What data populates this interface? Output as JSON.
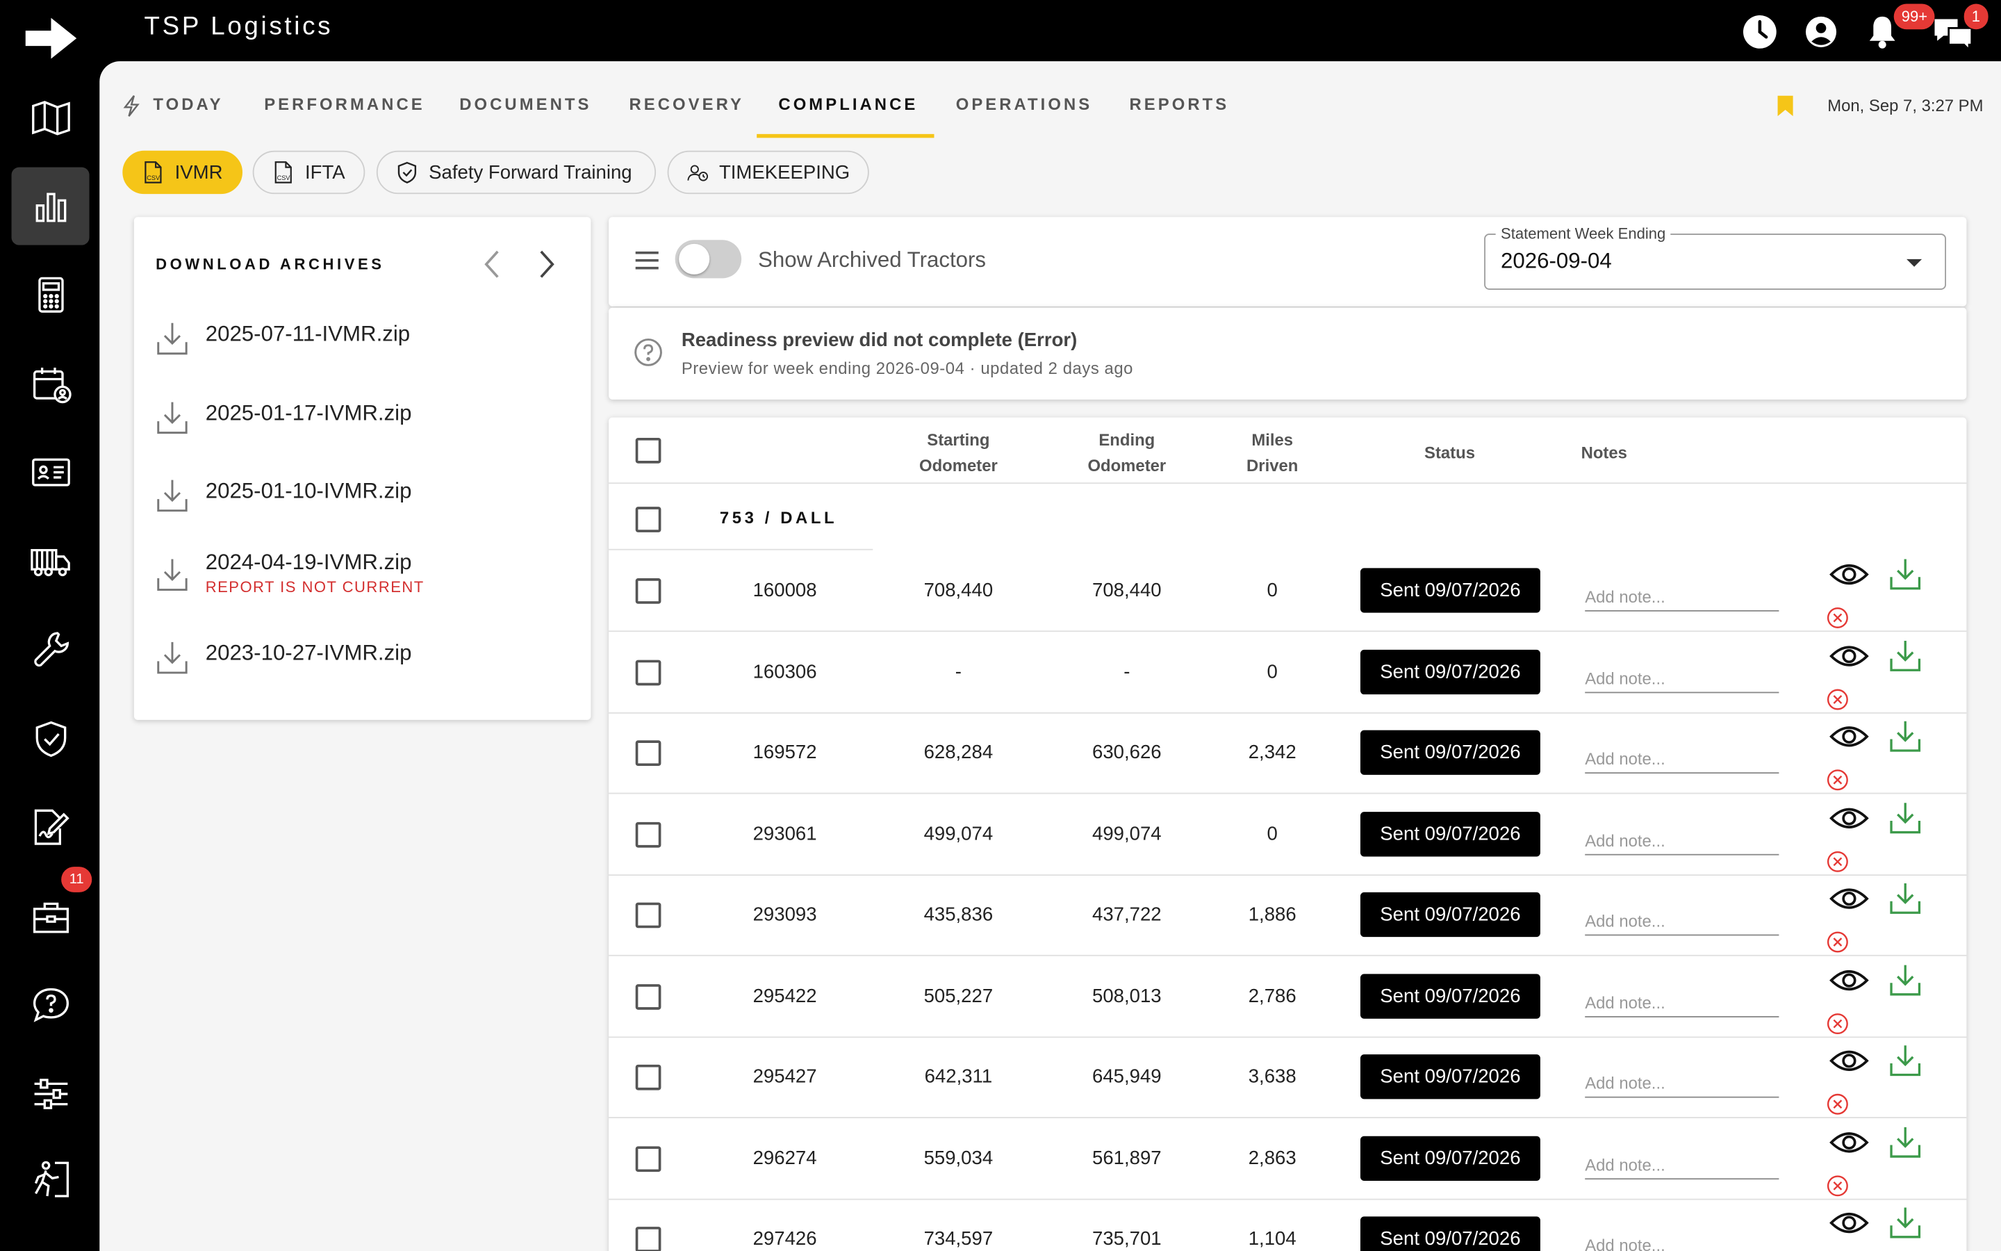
{
  "app": {
    "title": "TSP Logistics"
  },
  "topbar": {
    "icons": [
      "clock-icon",
      "account-icon",
      "bell-icon",
      "chat-icon"
    ],
    "notifications_badge": "99+",
    "messages_badge": "1"
  },
  "sidebar": {
    "items": [
      {
        "icon": "map-icon"
      },
      {
        "icon": "bar-chart-icon",
        "active": true
      },
      {
        "icon": "calculator-icon"
      },
      {
        "icon": "calendar-user-icon"
      },
      {
        "icon": "id-card-icon"
      },
      {
        "icon": "truck-icon"
      },
      {
        "icon": "wrench-icon"
      },
      {
        "icon": "shield-check-icon"
      },
      {
        "icon": "signature-icon"
      },
      {
        "icon": "toolbox-icon",
        "badge": "11"
      },
      {
        "icon": "help-chat-icon"
      },
      {
        "icon": "sliders-icon"
      },
      {
        "icon": "exit-runner-icon"
      }
    ]
  },
  "nav": {
    "tabs": [
      "TODAY",
      "PERFORMANCE",
      "DOCUMENTS",
      "RECOVERY",
      "COMPLIANCE",
      "OPERATIONS",
      "REPORTS"
    ],
    "active": "COMPLIANCE",
    "datetime": "Mon, Sep 7, 3:27 PM",
    "accent": "#f5c518"
  },
  "chips": [
    {
      "label": "IVMR",
      "icon": "csv-file-icon",
      "active": true
    },
    {
      "label": "IFTA",
      "icon": "csv-file-icon",
      "active": false
    },
    {
      "label": "Safety Forward Training",
      "icon": "shield-icon",
      "active": false
    },
    {
      "label": "TIMEKEEPING",
      "icon": "person-clock-icon",
      "active": false
    }
  ],
  "archives": {
    "title": "DOWNLOAD ARCHIVES",
    "files": [
      {
        "name": "2025-07-11-IVMR.zip",
        "warning": ""
      },
      {
        "name": "2025-01-17-IVMR.zip",
        "warning": ""
      },
      {
        "name": "2025-01-10-IVMR.zip",
        "warning": ""
      },
      {
        "name": "2024-04-19-IVMR.zip",
        "warning": "REPORT IS NOT CURRENT"
      },
      {
        "name": "2023-10-27-IVMR.zip",
        "warning": ""
      }
    ]
  },
  "filters": {
    "toggle_label": "Show Archived Tractors",
    "week_label": "Statement Week Ending",
    "week_value": "2026-09-04"
  },
  "readiness": {
    "title": "Readiness preview did not complete (Error)",
    "subtitle": "Preview for week ending 2026-09-04 · updated 2 days ago"
  },
  "table": {
    "headers": {
      "start": [
        "Starting",
        "Odometer"
      ],
      "end": [
        "Ending",
        "Odometer"
      ],
      "miles": [
        "Miles",
        "Driven"
      ],
      "status": "Status",
      "notes": "Notes"
    },
    "group": "753 / DALL",
    "note_placeholder": "Add note...",
    "rows": [
      {
        "unit": "160008",
        "start": "708,440",
        "end": "708,440",
        "miles": "0",
        "status": "Sent 09/07/2026"
      },
      {
        "unit": "160306",
        "start": "-",
        "end": "-",
        "miles": "0",
        "status": "Sent 09/07/2026"
      },
      {
        "unit": "169572",
        "start": "628,284",
        "end": "630,626",
        "miles": "2,342",
        "status": "Sent 09/07/2026"
      },
      {
        "unit": "293061",
        "start": "499,074",
        "end": "499,074",
        "miles": "0",
        "status": "Sent 09/07/2026"
      },
      {
        "unit": "293093",
        "start": "435,836",
        "end": "437,722",
        "miles": "1,886",
        "status": "Sent 09/07/2026"
      },
      {
        "unit": "295422",
        "start": "505,227",
        "end": "508,013",
        "miles": "2,786",
        "status": "Sent 09/07/2026"
      },
      {
        "unit": "295427",
        "start": "642,311",
        "end": "645,949",
        "miles": "3,638",
        "status": "Sent 09/07/2026"
      },
      {
        "unit": "296274",
        "start": "559,034",
        "end": "561,897",
        "miles": "2,863",
        "status": "Sent 09/07/2026"
      },
      {
        "unit": "297426",
        "start": "734,597",
        "end": "735,701",
        "miles": "1,104",
        "status": "Sent 09/07/2026"
      }
    ]
  }
}
